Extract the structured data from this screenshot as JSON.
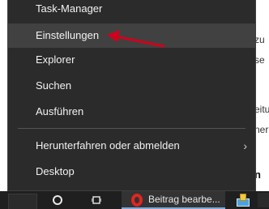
{
  "menu": {
    "items": [
      {
        "label": "Task-Manager",
        "hovered": false,
        "submenu": false
      },
      {
        "label": "Einstellungen",
        "hovered": true,
        "submenu": false
      },
      {
        "label": "Explorer",
        "hovered": false,
        "submenu": false
      },
      {
        "label": "Suchen",
        "hovered": false,
        "submenu": false
      },
      {
        "label": "Ausführen",
        "hovered": false,
        "submenu": false
      },
      {
        "label": "Herunterfahren oder abmelden",
        "hovered": false,
        "submenu": true
      },
      {
        "label": "Desktop",
        "hovered": false,
        "submenu": false
      }
    ],
    "submenu_icon": "chevron-right-icon"
  },
  "annotation": {
    "icon": "red-arrow-icon",
    "color": "#d0021b"
  },
  "taskbar": {
    "start_icon": "windows-start-icon",
    "search_icon": "search-circle-icon",
    "taskview_icon": "task-view-icon",
    "active_app": {
      "icon": "opera-icon",
      "title": "Beitrag bearbe..."
    },
    "tray_icon": "notification-tray-icon"
  },
  "background_fragments": [
    "zu",
    "se",
    "eitu",
    "ner",
    "n"
  ]
}
